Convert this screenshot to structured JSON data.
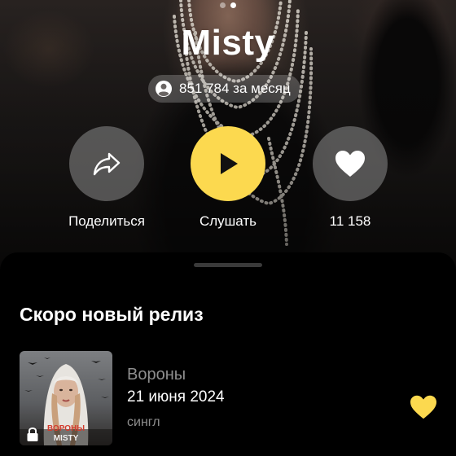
{
  "artist": {
    "name": "Misty",
    "listeners_text": "851 784 за месяц"
  },
  "pager": {
    "count": 2,
    "active_index": 1
  },
  "actions": {
    "share_label": "Поделиться",
    "listen_label": "Слушать",
    "likes_count": "11 158"
  },
  "upcoming": {
    "section_title": "Скоро новый релиз",
    "release": {
      "cover_caption": "ВОРОНЫ",
      "cover_artist": "MISTY",
      "title": "Вороны",
      "date": "21 июня 2024",
      "type": "сингл"
    }
  },
  "icons": {
    "listeners": "person-icon",
    "share": "share-arrow-icon",
    "listen": "play-icon",
    "like": "heart-icon",
    "cover_lock": "lock-icon",
    "release_like": "heart-icon"
  },
  "colors": {
    "accent": "#fcd94f",
    "background": "#000000",
    "muted_text": "#8e8e8e",
    "circle_button": "#8c8c8c"
  }
}
